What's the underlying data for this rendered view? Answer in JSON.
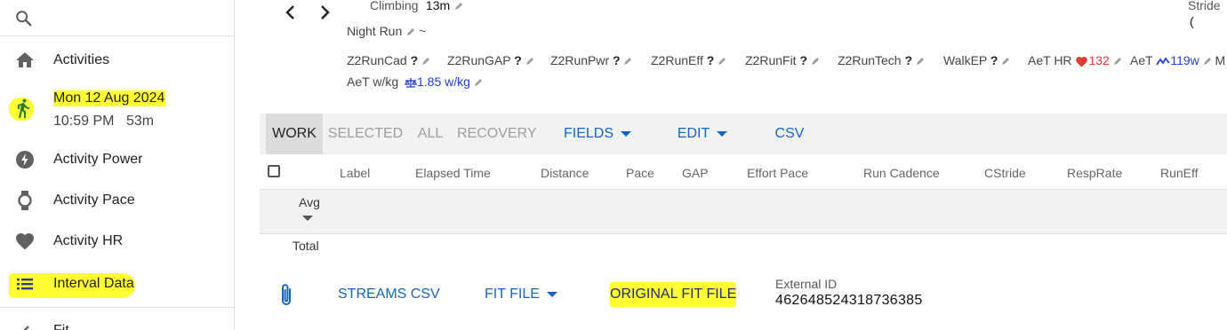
{
  "sidebar": {
    "items": [
      {
        "label": "Activities"
      },
      {
        "date": "Mon 12 Aug 2024",
        "time": "10:59 PM",
        "duration": "53m"
      },
      {
        "label": "Activity Power"
      },
      {
        "label": "Activity Pace"
      },
      {
        "label": "Activity HR"
      },
      {
        "label": "Interval Data"
      },
      {
        "label": "Fit..."
      }
    ]
  },
  "header": {
    "climbing_label": "Climbing",
    "climbing_value": "13m",
    "stride_label": "Stride",
    "stride_value": "(",
    "activity_name": "Night Run",
    "tilde": "~"
  },
  "fields": [
    {
      "label": "Z2RunCad",
      "value": "?"
    },
    {
      "label": "Z2RunGAP",
      "value": "?"
    },
    {
      "label": "Z2RunPwr",
      "value": "?"
    },
    {
      "label": "Z2RunEff",
      "value": "?"
    },
    {
      "label": "Z2RunFit",
      "value": "?"
    },
    {
      "label": "Z2RunTech",
      "value": "?"
    },
    {
      "label": "WalkEP",
      "value": "?"
    },
    {
      "label": "AeT HR",
      "value": "132"
    },
    {
      "label": "AeT",
      "value": "119w"
    },
    {
      "label": "M",
      "value": ""
    },
    {
      "label": "AeT w/kg",
      "value": "1.85 w/kg"
    }
  ],
  "toolbar": {
    "work": "WORK",
    "selected": "SELECTED",
    "all": "ALL",
    "recovery": "RECOVERY",
    "fields": "FIELDS",
    "edit": "EDIT",
    "csv": "CSV"
  },
  "table": {
    "columns": [
      "Label",
      "Elapsed Time",
      "Distance",
      "Pace",
      "GAP",
      "Effort Pace",
      "Run Cadence",
      "CStride",
      "RespRate",
      "RunEff"
    ],
    "avg_label": "Avg",
    "total_label": "Total"
  },
  "files": {
    "streams_csv": "STREAMS CSV",
    "fit_file": "FIT FILE",
    "original_fit_file": "ORIGINAL FIT FILE",
    "external_id_label": "External ID",
    "external_id_value": "462648524318736385"
  },
  "colors": {
    "accent": "#1565c0",
    "highlight": "#ffff33",
    "heart": "#e53935",
    "watts": "#1e3fcc"
  }
}
